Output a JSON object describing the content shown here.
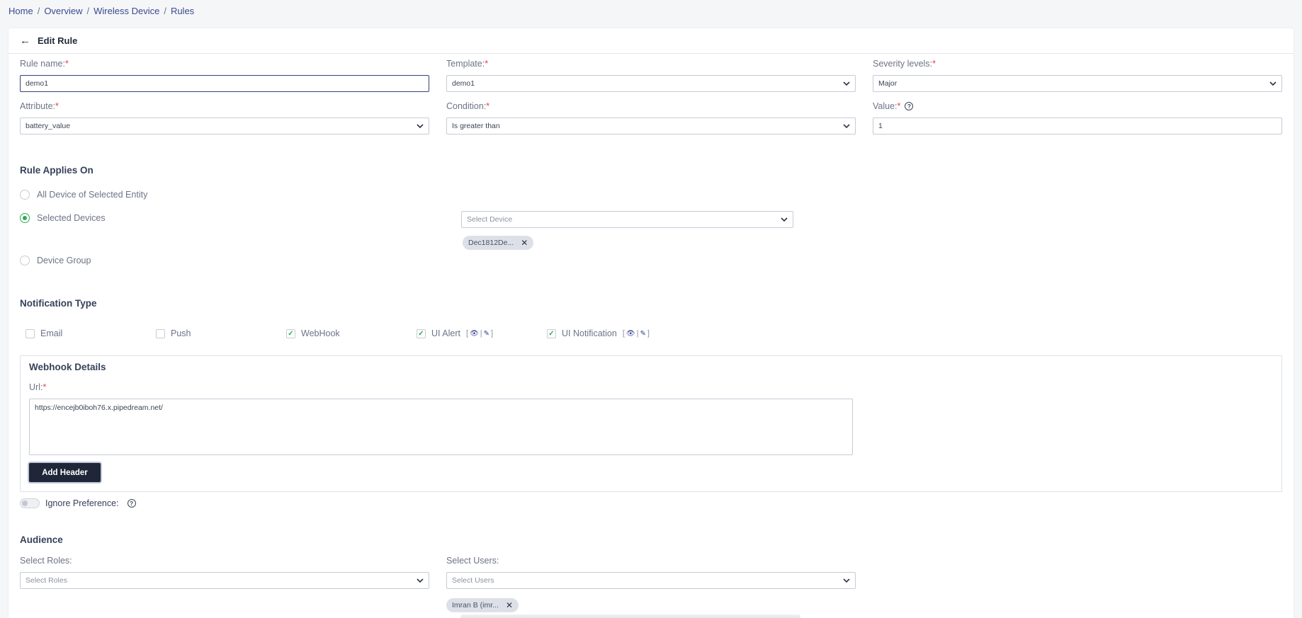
{
  "breadcrumb": [
    "Home",
    "Overview",
    "Wireless Device",
    "Rules"
  ],
  "header": {
    "title": "Edit Rule"
  },
  "form": {
    "rule_name": {
      "label": "Rule name:",
      "value": "demo1"
    },
    "template": {
      "label": "Template:",
      "value": "demo1"
    },
    "severity": {
      "label": "Severity levels:",
      "value": "Major"
    },
    "attribute": {
      "label": "Attribute:",
      "value": "battery_value"
    },
    "condition": {
      "label": "Condition:",
      "value": "Is greater than"
    },
    "value": {
      "label": "Value:",
      "value": "1"
    },
    "required_mark": "*"
  },
  "applies_on": {
    "title": "Rule Applies On",
    "options": [
      "All Device of Selected Entity",
      "Selected Devices",
      "Device Group"
    ],
    "selected_index": 1,
    "device_select_placeholder": "Select Device",
    "device_chip": "Dec1812De..."
  },
  "notification": {
    "title": "Notification Type",
    "types": [
      {
        "label": "Email",
        "checked": false
      },
      {
        "label": "Push",
        "checked": false
      },
      {
        "label": "WebHook",
        "checked": true
      },
      {
        "label": "UI Alert",
        "checked": true
      },
      {
        "label": "UI Notification",
        "checked": true
      }
    ]
  },
  "webhook": {
    "title": "Webhook Details",
    "url_label": "Url:",
    "url_value": "https://encejb0iboh76.x.pipedream.net/",
    "add_header": "Add Header"
  },
  "ignore_preference": {
    "label": "Ignore Preference:",
    "on": false
  },
  "audience": {
    "title": "Audience",
    "roles_label": "Select Roles:",
    "roles_placeholder": "Select Roles",
    "users_label": "Select Users:",
    "users_placeholder": "Select Users",
    "user_chip": "Imran B (imr..."
  },
  "colors": {
    "accent": "#2eaa52",
    "dark_button": "#1f2638",
    "link": "#3a4a8c",
    "required": "#e0424f"
  }
}
